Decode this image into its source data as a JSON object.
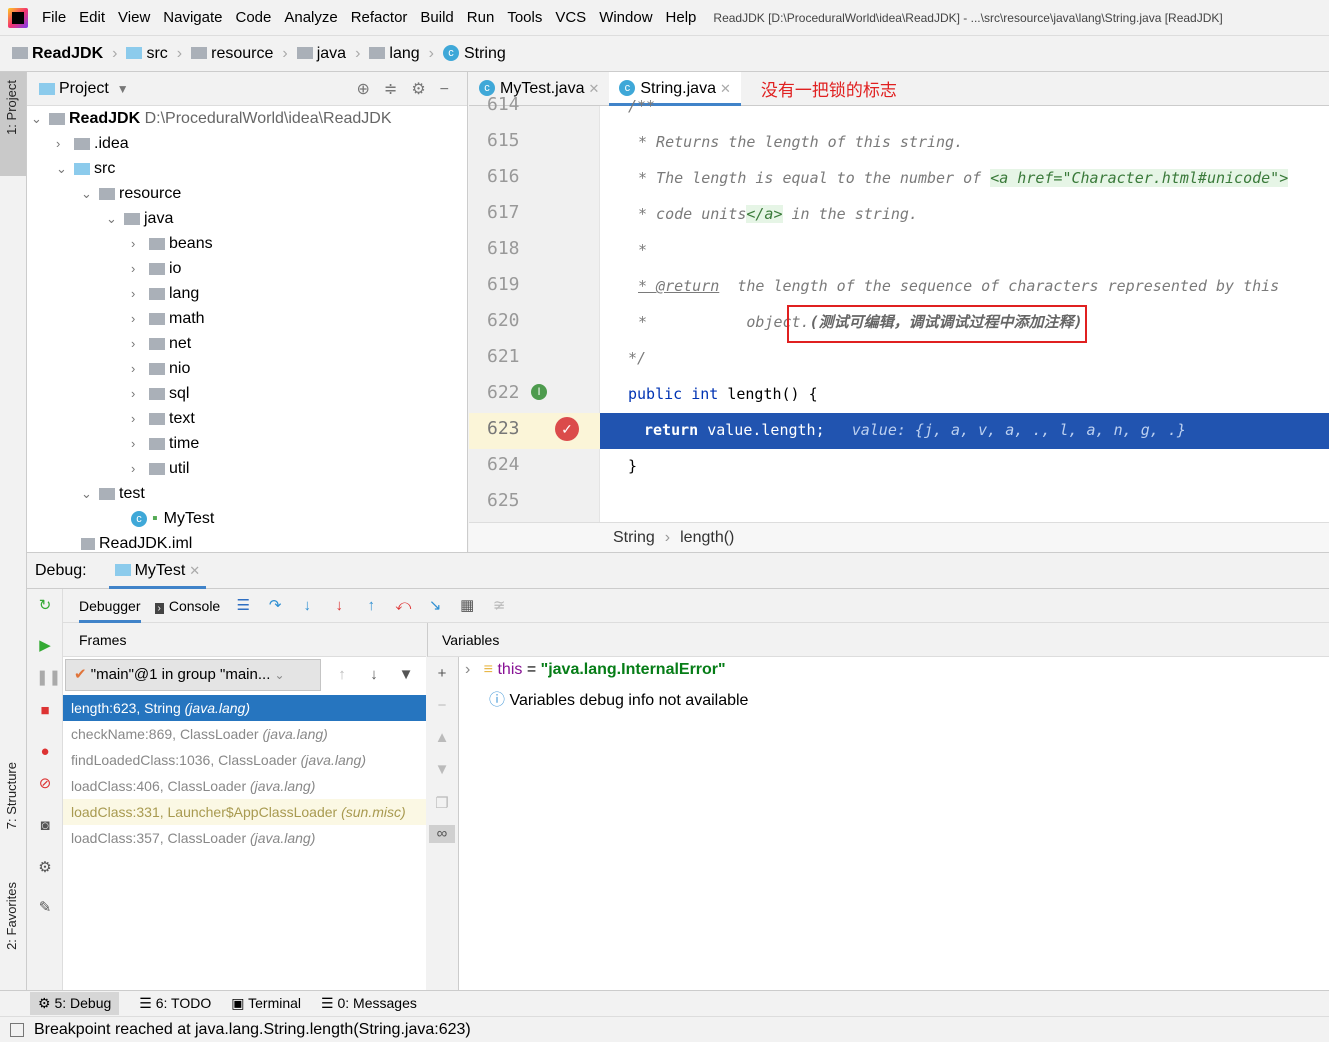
{
  "menu": [
    "File",
    "Edit",
    "View",
    "Navigate",
    "Code",
    "Analyze",
    "Refactor",
    "Build",
    "Run",
    "Tools",
    "VCS",
    "Window",
    "Help"
  ],
  "window_title": "ReadJDK [D:\\ProceduralWorld\\idea\\ReadJDK] - ...\\src\\resource\\java\\lang\\String.java [ReadJDK]",
  "breadcrumb": [
    "ReadJDK",
    "src",
    "resource",
    "java",
    "lang",
    "String"
  ],
  "project": {
    "title": "Project",
    "root": "ReadJDK",
    "root_path": "D:\\ProceduralWorld\\idea\\ReadJDK",
    "items": [
      ".idea",
      "src",
      "resource",
      "java",
      "beans",
      "io",
      "lang",
      "math",
      "net",
      "nio",
      "sql",
      "text",
      "time",
      "util",
      "test",
      "MyTest",
      "ReadJDK.iml"
    ]
  },
  "side_tabs": {
    "project": "1: Project",
    "structure": "7: Structure",
    "favorites": "2: Favorites"
  },
  "editor": {
    "tabs": [
      "MyTest.java",
      "String.java"
    ],
    "annotation": "没有一把锁的标志",
    "lines": [
      {
        "n": "614",
        "t": "/**"
      },
      {
        "n": "615",
        "t": "* Returns the length of this string."
      },
      {
        "n": "616",
        "t": "* The length is equal to the number of ",
        "tag": "<a href=\"Character.html#unicode\">"
      },
      {
        "n": "617",
        "t": "* code units",
        "tag": "</a>",
        "t2": " in the string."
      },
      {
        "n": "618",
        "t": "*"
      },
      {
        "n": "619",
        "t": "* @return",
        "t2": "  the length of the sequence of characters represented by this"
      },
      {
        "n": "620",
        "t": "*           object.",
        "note": "(测试可编辑，调试调试过程中添加注释)"
      },
      {
        "n": "621",
        "t": "*/"
      },
      {
        "n": "622",
        "kw1": "public",
        "kw2": "int",
        "t": "length() {"
      },
      {
        "n": "623",
        "kw1": "return",
        "t": "value.length;",
        "hint": "value: {j, a, v, a, ., l, a, n, g, .}"
      },
      {
        "n": "624",
        "t": "}"
      },
      {
        "n": "625",
        "t": ""
      }
    ],
    "crumbs": [
      "String",
      "length()"
    ]
  },
  "debug": {
    "label": "Debug:",
    "session": "MyTest",
    "tabs": [
      "Debugger",
      "Console"
    ],
    "frames_title": "Frames",
    "variables_title": "Variables",
    "thread": "\"main\"@1 in group \"main...",
    "frames": [
      {
        "m": "length:623, String ",
        "p": "(java.lang)"
      },
      {
        "m": "checkName:869, ClassLoader ",
        "p": "(java.lang)"
      },
      {
        "m": "findLoadedClass:1036, ClassLoader ",
        "p": "(java.lang)"
      },
      {
        "m": "loadClass:406, ClassLoader ",
        "p": "(java.lang)"
      },
      {
        "m": "loadClass:331, Launcher$AppClassLoader ",
        "p": "(sun.misc)"
      },
      {
        "m": "loadClass:357, ClassLoader ",
        "p": "(java.lang)"
      }
    ],
    "vars": {
      "this_name": "this",
      "eq": " = ",
      "this_val": "\"java.lang.InternalError\"",
      "info": "Variables debug info not available"
    }
  },
  "bottom_tabs": [
    "5: Debug",
    "6: TODO",
    "Terminal",
    "0: Messages"
  ],
  "status": "Breakpoint reached at java.lang.String.length(String.java:623)",
  "colors": {
    "selection": "#2154b0",
    "frame_selected": "#2675bf",
    "annotation": "#e02020"
  }
}
